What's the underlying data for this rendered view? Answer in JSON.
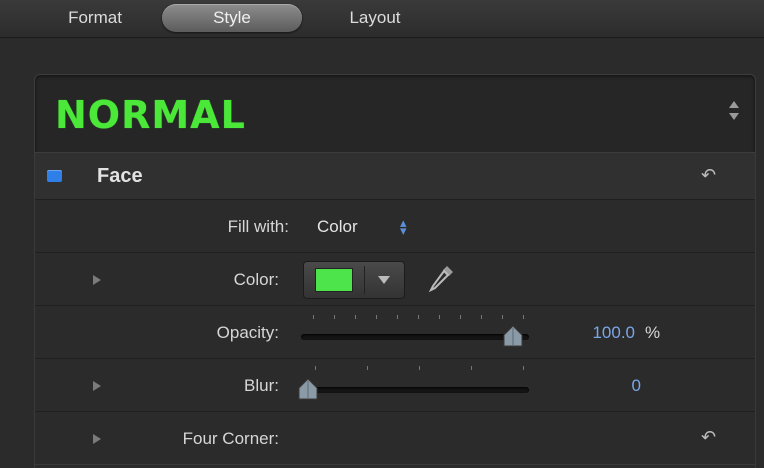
{
  "tabs": [
    {
      "label": "Format",
      "active": false
    },
    {
      "label": "Style",
      "active": true
    },
    {
      "label": "Layout",
      "active": false
    }
  ],
  "style_preset": {
    "name": "NORMAL",
    "name_color": "#4be83a"
  },
  "face_section": {
    "title": "Face",
    "enabled": true,
    "checkbox_color": "#2f7fe8"
  },
  "fill_with": {
    "label": "Fill with:",
    "value": "Color"
  },
  "color": {
    "label": "Color:",
    "swatch_color": "#4de34a"
  },
  "opacity": {
    "label": "Opacity:",
    "value": "100.0",
    "unit": "%",
    "fraction": 1.0
  },
  "blur": {
    "label": "Blur:",
    "value": "0",
    "fraction": 0.0
  },
  "four_corner": {
    "label": "Four Corner:"
  },
  "colors": {
    "accent_blue": "#7aa6e8",
    "background": "#2b2b2b"
  }
}
